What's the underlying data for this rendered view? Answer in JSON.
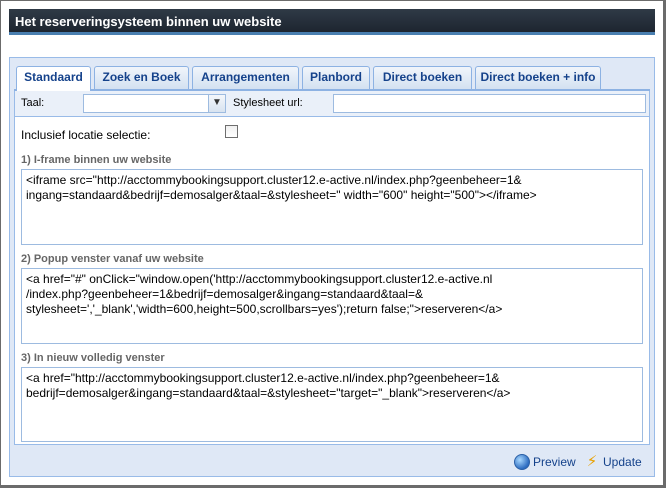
{
  "window": {
    "title": "Het reserveringsysteem binnen uw website"
  },
  "tabs": [
    {
      "label": "Standaard",
      "active": true
    },
    {
      "label": "Zoek en Boek",
      "active": false
    },
    {
      "label": "Arrangementen",
      "active": false
    },
    {
      "label": "Planbord",
      "active": false
    },
    {
      "label": "Direct boeken",
      "active": false
    },
    {
      "label": "Direct boeken + info",
      "active": false
    }
  ],
  "form": {
    "taal_label": "Taal:",
    "taal_value": "",
    "stylesheet_label": "Stylesheet url:",
    "stylesheet_value": "",
    "locatie_label": "Inclusief locatie selectie:",
    "locatie_checked": false
  },
  "sections": [
    {
      "title": "1) I-frame binnen uw website",
      "code": "<iframe src=\"http://acctommybookingsupport.cluster12.e-active.nl/index.php?geenbeheer=1&\ningang=standaard&bedrijf=demosalger&taal=&stylesheet=\" width=\"600\" height=\"500\"></iframe>"
    },
    {
      "title": "2) Popup venster vanaf uw website",
      "code": "<a href=\"#\" onClick=\"window.open('http://acctommybookingsupport.cluster12.e-active.nl\n/index.php?geenbeheer=1&bedrijf=demosalger&ingang=standaard&taal=&\nstylesheet=','_blank','width=600,height=500,scrollbars=yes');return false;\">reserveren</a>"
    },
    {
      "title": "3) In nieuw volledig venster",
      "code": "<a href=\"http://acctommybookingsupport.cluster12.e-active.nl/index.php?geenbeheer=1&\nbedrijf=demosalger&ingang=standaard&taal=&stylesheet=\"target=\"_blank\">reserveren</a>"
    }
  ],
  "footer": {
    "preview_label": "Preview",
    "update_label": "Update"
  },
  "icons": {
    "select_arrow": "chevron-down-icon",
    "preview": "globe-icon",
    "update": "lightning-icon"
  },
  "colors": {
    "title_bg": "#1d2530",
    "accent": "#4a7fb0",
    "tab_text": "#15428b",
    "panel_bg": "#dfe8f6"
  }
}
